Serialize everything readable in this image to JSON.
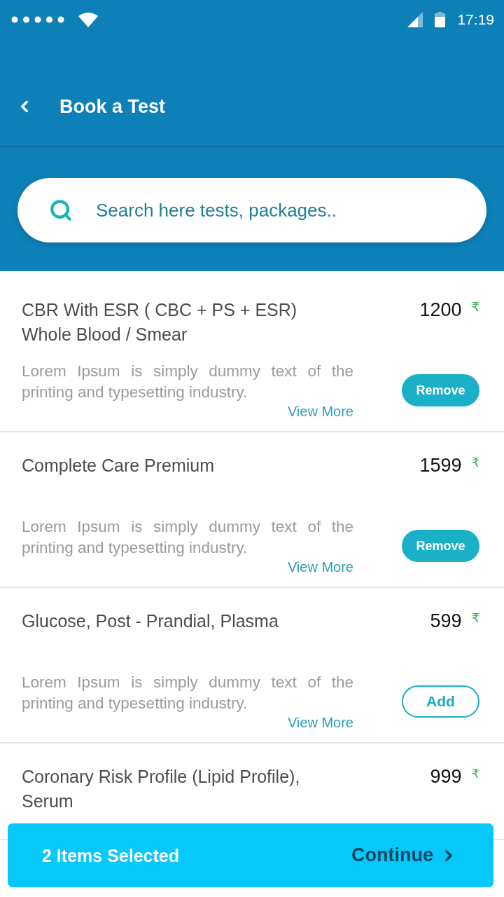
{
  "status_bar": {
    "time": "17:19"
  },
  "header": {
    "title": "Book a Test"
  },
  "search": {
    "placeholder": "Search here tests, packages.."
  },
  "tests": [
    {
      "name": "CBR With ESR ( CBC + PS + ESR) Whole Blood / Smear",
      "price": "1200",
      "currency": "₹",
      "description": "Lorem Ipsum is simply dummy text of the printing and typesetting industry.",
      "link": "View More",
      "button": "Remove",
      "selected": true
    },
    {
      "name": "Complete Care Premium",
      "price": "1599",
      "currency": "₹",
      "description": "Lorem Ipsum is simply dummy text of the printing and typesetting industry.",
      "link": "View More",
      "button": "Remove",
      "selected": true
    },
    {
      "name": "Glucose, Post - Prandial, Plasma",
      "price": "599",
      "currency": "₹",
      "description": "Lorem Ipsum is simply dummy text of the printing and typesetting industry.",
      "link": "View More",
      "button": "Add",
      "selected": false
    },
    {
      "name": "Coronary Risk Profile (Lipid Profile), Serum",
      "price": "999",
      "currency": "₹"
    }
  ],
  "footer": {
    "summary": "2 Items Selected",
    "action": "Continue"
  }
}
